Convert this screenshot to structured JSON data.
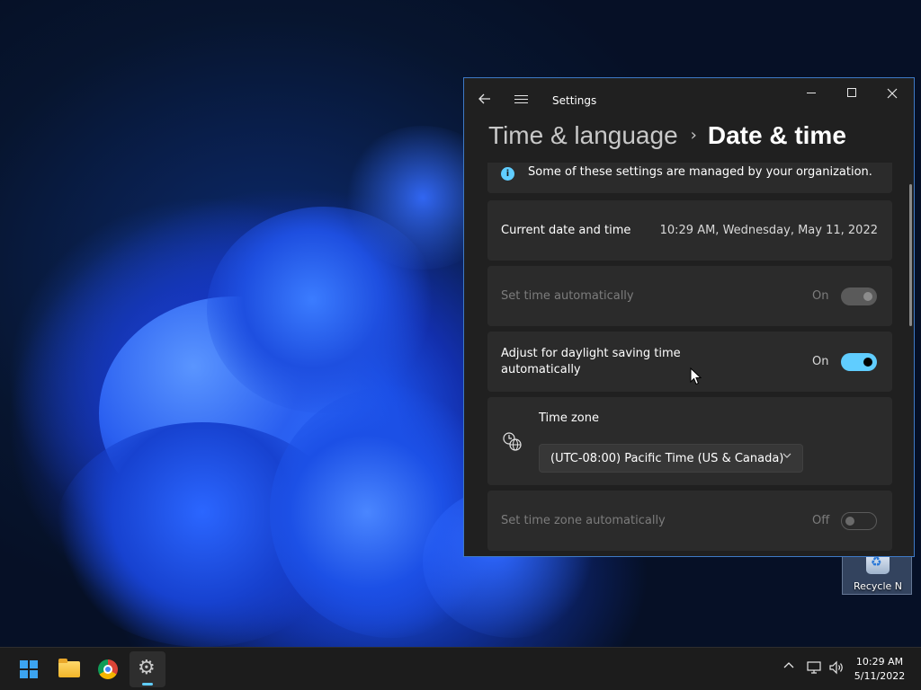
{
  "window": {
    "app_title": "Settings",
    "back_icon": "back-arrow-icon",
    "menu_icon": "hamburger-menu-icon",
    "minimize_icon": "minimize-icon",
    "maximize_icon": "maximize-icon",
    "close_icon": "close-icon"
  },
  "breadcrumb": {
    "parent": "Time & language",
    "separator": "›",
    "current": "Date & time"
  },
  "info_banner": {
    "icon": "info-icon",
    "text": "Some of these settings are managed by your organization."
  },
  "settings": {
    "current_datetime": {
      "label": "Current date and time",
      "value": "10:29 AM, Wednesday, May 11, 2022"
    },
    "set_time_auto": {
      "label": "Set time automatically",
      "state": "On",
      "enabled": false,
      "checked": true
    },
    "dst_auto": {
      "label_line1": "Adjust for daylight saving time",
      "label_line2": "automatically",
      "state": "On",
      "enabled": true,
      "checked": true
    },
    "time_zone": {
      "icon": "time-zone-globe-clock-icon",
      "label": "Time zone",
      "selected": "(UTC-08:00) Pacific Time (US & Canada)"
    },
    "set_tz_auto": {
      "label": "Set time zone automatically",
      "state": "Off",
      "enabled": false,
      "checked": false
    }
  },
  "desktop": {
    "recycle_bin_label": "Recycle N"
  },
  "taskbar": {
    "apps": [
      "start-icon",
      "file-explorer-icon",
      "chrome-icon",
      "settings-icon"
    ],
    "tray": [
      "show-hidden-icons-chevron",
      "network-icon",
      "volume-icon"
    ],
    "clock_time": "10:29 AM",
    "clock_date": "5/11/2022"
  },
  "colors": {
    "accent": "#60cdff",
    "window_bg": "#202020",
    "card_bg": "#2b2b2b",
    "window_border": "#3e7ac6"
  }
}
